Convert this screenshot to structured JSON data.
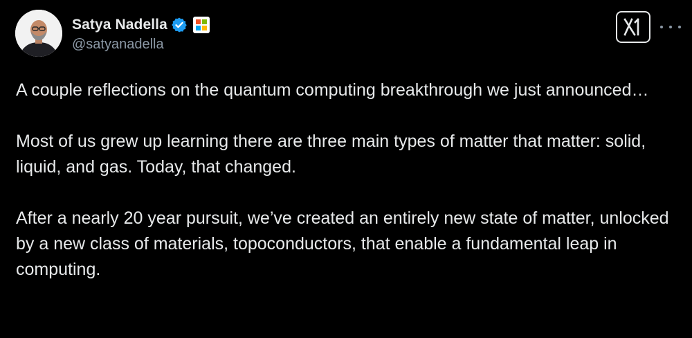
{
  "author": {
    "display_name": "Satya Nadella",
    "handle": "@satyanadella",
    "verified_color": "#1d9bf0"
  },
  "icons": {
    "verified": "verified-check-icon",
    "affiliate": "microsoft-logo-icon",
    "platform": "x-logo-icon",
    "menu": "more-options-icon"
  },
  "tweet": {
    "paragraphs": [
      "A couple reflections on the quantum computing breakthrough we just announced…",
      "Most of us grew up learning there are three main types of matter that matter: solid, liquid, and gas. Today, that changed.",
      "After a nearly 20 year pursuit, we’ve created an entirely new state of matter, unlocked by a new class of materials, topoconductors, that enable a fundamental leap in computing."
    ]
  },
  "colors": {
    "background": "#000000",
    "text_primary": "#e7e9ea",
    "text_secondary": "#8b98a5",
    "ms_red": "#f25022",
    "ms_green": "#7fba00",
    "ms_blue": "#00a4ef",
    "ms_yellow": "#ffb900"
  }
}
